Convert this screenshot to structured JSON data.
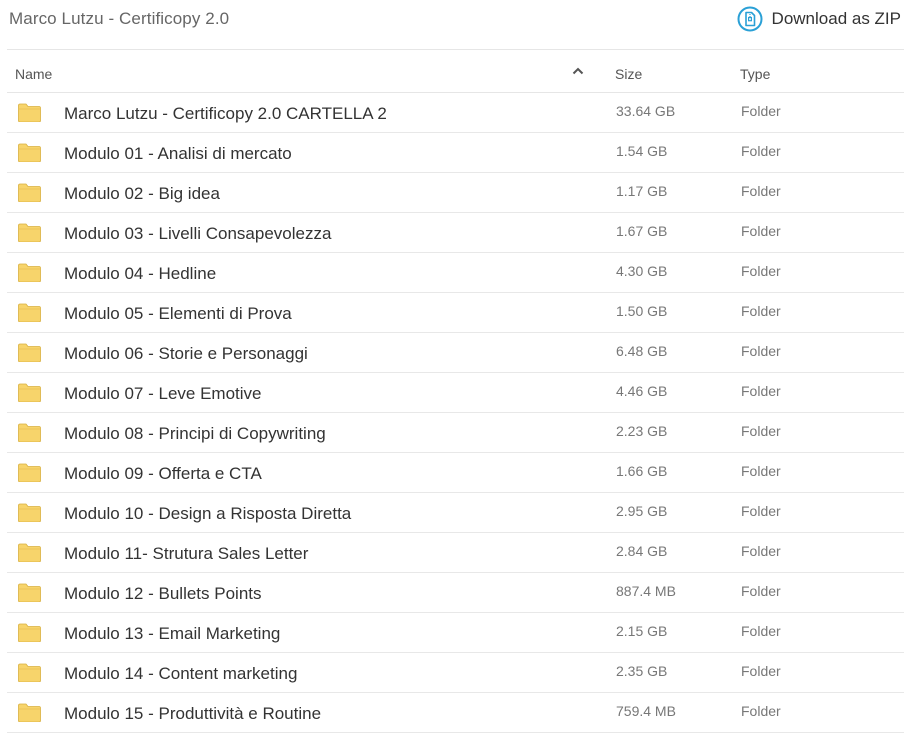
{
  "header": {
    "title": "Marco Lutzu - Certificopy 2.0",
    "download_label": "Download as ZIP",
    "download_icon": "zip-file-icon"
  },
  "columns": {
    "name": "Name",
    "size": "Size",
    "type": "Type",
    "sort_icon": "chevron-up-icon"
  },
  "colors": {
    "folder": "#f7d46b",
    "accent": "#2aa0d6"
  },
  "rows": [
    {
      "name": "Marco Lutzu - Certificopy 2.0 CARTELLA 2",
      "size": "33.64 GB",
      "type": "Folder"
    },
    {
      "name": "Modulo 01 - Analisi di mercato",
      "size": "1.54 GB",
      "type": "Folder"
    },
    {
      "name": "Modulo 02 - Big idea",
      "size": "1.17 GB",
      "type": "Folder"
    },
    {
      "name": "Modulo 03 - Livelli Consapevolezza",
      "size": "1.67 GB",
      "type": "Folder"
    },
    {
      "name": "Modulo 04 - Hedline",
      "size": "4.30 GB",
      "type": "Folder"
    },
    {
      "name": "Modulo 05 - Elementi di Prova",
      "size": "1.50 GB",
      "type": "Folder"
    },
    {
      "name": "Modulo 06 - Storie e Personaggi",
      "size": "6.48 GB",
      "type": "Folder"
    },
    {
      "name": "Modulo 07 - Leve Emotive",
      "size": "4.46 GB",
      "type": "Folder"
    },
    {
      "name": "Modulo 08 - Principi di Copywriting",
      "size": "2.23 GB",
      "type": "Folder"
    },
    {
      "name": "Modulo 09 - Offerta e CTA",
      "size": "1.66 GB",
      "type": "Folder"
    },
    {
      "name": "Modulo 10 - Design a Risposta Diretta",
      "size": "2.95 GB",
      "type": "Folder"
    },
    {
      "name": "Modulo 11- Strutura Sales Letter",
      "size": "2.84 GB",
      "type": "Folder"
    },
    {
      "name": "Modulo 12 - Bullets Points",
      "size": "887.4 MB",
      "type": "Folder"
    },
    {
      "name": "Modulo 13 - Email Marketing",
      "size": "2.15 GB",
      "type": "Folder"
    },
    {
      "name": "Modulo 14 - Content marketing",
      "size": "2.35 GB",
      "type": "Folder"
    },
    {
      "name": "Modulo 15 - Produttività e Routine",
      "size": "759.4 MB",
      "type": "Folder"
    }
  ]
}
